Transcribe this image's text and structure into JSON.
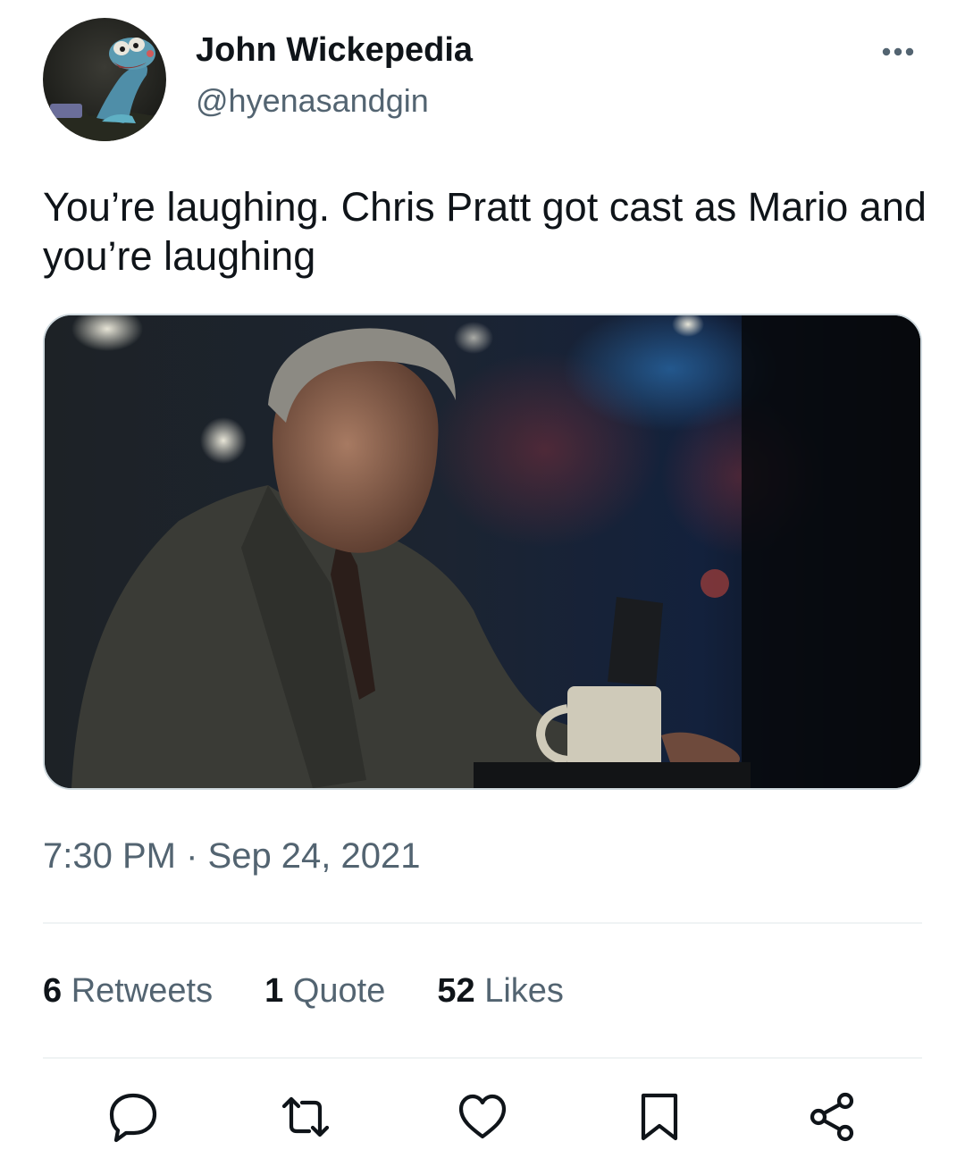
{
  "author": {
    "display_name": "John Wickepedia",
    "handle": "@hyenasandgin",
    "avatar_icon": "cartoon-dog-avatar"
  },
  "tweet": {
    "text": "You’re laughing. Chris Pratt got cast as Mario and you’re laughing",
    "timestamp": "7:30 PM · Sep 24, 2021",
    "media_description": ""
  },
  "stats": {
    "retweets": {
      "count": "6",
      "label": "Retweets"
    },
    "quotes": {
      "count": "1",
      "label": "Quote"
    },
    "likes": {
      "count": "52",
      "label": "Likes"
    }
  },
  "actions": {
    "reply_icon": "reply-icon",
    "retweet_icon": "retweet-icon",
    "like_icon": "heart-icon",
    "bookmark_icon": "bookmark-icon",
    "share_icon": "share-icon"
  },
  "colors": {
    "text_primary": "#0f1419",
    "text_secondary": "#536471",
    "divider": "#eff3f4",
    "media_border": "#cfd9de"
  }
}
